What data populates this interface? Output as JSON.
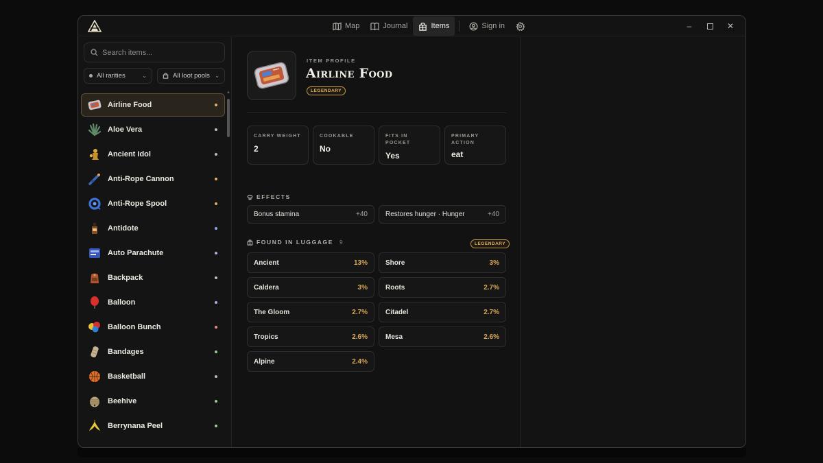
{
  "nav": {
    "items": [
      {
        "label": "Map",
        "icon": "map-icon"
      },
      {
        "label": "Journal",
        "icon": "book-icon"
      },
      {
        "label": "Items",
        "icon": "bag-icon",
        "active": true
      }
    ],
    "sign_in": "Sign in"
  },
  "sidebar": {
    "search_placeholder": "Search items...",
    "filter_rarity": "All rarities",
    "filter_pools": "All loot pools",
    "items": [
      {
        "name": "Airline Food",
        "rarity_color": "#e3b062",
        "selected": true
      },
      {
        "name": "Aloe Vera",
        "rarity_color": "#bcbcbc"
      },
      {
        "name": "Ancient Idol",
        "rarity_color": "#bcbcbc"
      },
      {
        "name": "Anti-Rope Cannon",
        "rarity_color": "#e3b062"
      },
      {
        "name": "Anti-Rope Spool",
        "rarity_color": "#e3b062"
      },
      {
        "name": "Antidote",
        "rarity_color": "#8ea6e6"
      },
      {
        "name": "Auto Parachute",
        "rarity_color": "#b9a6e6"
      },
      {
        "name": "Backpack",
        "rarity_color": "#bcbcbc"
      },
      {
        "name": "Balloon",
        "rarity_color": "#b9a6e6"
      },
      {
        "name": "Balloon Bunch",
        "rarity_color": "#e98b8b"
      },
      {
        "name": "Bandages",
        "rarity_color": "#8fcf8f"
      },
      {
        "name": "Basketball",
        "rarity_color": "#bcbcbc"
      },
      {
        "name": "Beehive",
        "rarity_color": "#8fcf8f"
      },
      {
        "name": "Berrynana Peel",
        "rarity_color": "#8fcf8f"
      }
    ]
  },
  "detail": {
    "profile_label": "ITEM PROFILE",
    "title": "Airline Food",
    "rarity": "LEGENDARY",
    "stats": [
      {
        "key": "CARRY WEIGHT",
        "value": "2"
      },
      {
        "key": "COOKABLE",
        "value": "No"
      },
      {
        "key": "FITS IN POCKET",
        "value": "Yes"
      },
      {
        "key": "PRIMARY ACTION",
        "value": "eat"
      }
    ],
    "effects_heading": "EFFECTS",
    "effects": [
      {
        "label": "Bonus stamina",
        "value": "+40"
      },
      {
        "label": "Restores hunger · Hunger",
        "value": "+40"
      }
    ],
    "luggage_heading": "FOUND IN LUGGAGE",
    "luggage_count": "9",
    "luggage_badge": "LEGENDARY",
    "luggage": [
      {
        "biome": "Ancient",
        "pct": "13%"
      },
      {
        "biome": "Shore",
        "pct": "3%"
      },
      {
        "biome": "Caldera",
        "pct": "3%"
      },
      {
        "biome": "Roots",
        "pct": "2.7%"
      },
      {
        "biome": "The Gloom",
        "pct": "2.7%"
      },
      {
        "biome": "Citadel",
        "pct": "2.7%"
      },
      {
        "biome": "Tropics",
        "pct": "2.6%"
      },
      {
        "biome": "Mesa",
        "pct": "2.6%"
      },
      {
        "biome": "Alpine",
        "pct": "2.4%"
      }
    ]
  }
}
